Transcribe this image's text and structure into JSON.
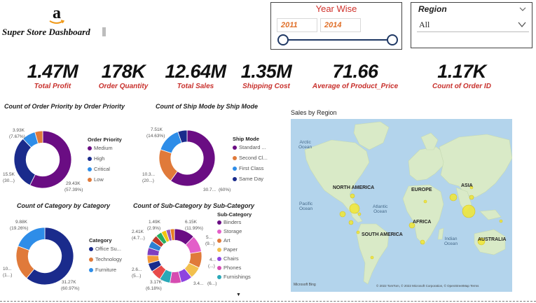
{
  "header": {
    "logo_text": "a",
    "title": "Super Store Dashboard"
  },
  "slicer_year": {
    "title": "Year Wise",
    "start": "2011",
    "end": "2014"
  },
  "slicer_region": {
    "title": "Region",
    "selected": "All"
  },
  "kpis": [
    {
      "value": "1.47M",
      "label": "Total Profit"
    },
    {
      "value": "178K",
      "label": "Order Quantity"
    },
    {
      "value": "12.64M",
      "label": "Total Sales"
    },
    {
      "value": "1.35M",
      "label": "Shipping Cost"
    },
    {
      "value": "71.66",
      "label": "Average of Product_Price"
    },
    {
      "value": "1.17K",
      "label": "Count of  Order ID"
    }
  ],
  "colors": {
    "accent_red": "#c8302c",
    "slider_blue": "#1f3864",
    "map_water": "#b3d4ec",
    "map_land": "#d9eac7"
  },
  "chart_data": [
    {
      "type": "pie",
      "title": "Count of Order Priority by Order Priority",
      "legend_title": "Order Priority",
      "categories": [
        "Medium",
        "High",
        "Critical",
        "Low"
      ],
      "values": [
        57.39,
        30.5,
        7.67,
        4.44
      ],
      "colors": [
        "#6a0d83",
        "#1a2b8c",
        "#2e8de8",
        "#e07a3a"
      ],
      "labels": {
        "a": "3.93K",
        "b": "(7.67%)",
        "c": "15.5K",
        "d": "(30...)",
        "e": "29.43K",
        "f": "(57.39%)"
      }
    },
    {
      "type": "pie",
      "title": "Count of Ship Mode by Ship Mode",
      "legend_title": "Ship Mode",
      "categories": [
        "Standard ...",
        "Second Cl...",
        "First Class",
        "Same Day"
      ],
      "values": [
        60,
        20,
        14.63,
        5.37
      ],
      "colors": [
        "#6a0d83",
        "#e07a3a",
        "#2e8de8",
        "#1a2b8c"
      ],
      "labels": {
        "a": "7.51K",
        "b": "(14.63%)",
        "c": "10.3...",
        "d": "(20...)",
        "e": "30.7...",
        "f": "(60%)"
      }
    },
    {
      "type": "pie",
      "title": "Count of Category by Category",
      "legend_title": "Category",
      "categories": [
        "Office Su...",
        "Technology",
        "Furniture"
      ],
      "values": [
        60.97,
        19.77,
        19.26
      ],
      "colors": [
        "#1a2b8c",
        "#e07a3a",
        "#2e8de8"
      ],
      "labels": {
        "a": "9.88K",
        "b": "(19.26%)",
        "c": "10...",
        "d": "(1...)",
        "e": "31.27K",
        "f": "(60.97%)"
      }
    },
    {
      "type": "pie",
      "title": "Count of Sub-Category by Sub-Category",
      "legend_title": "Sub-Category",
      "categories": [
        "Binders",
        "Storage",
        "Art",
        "Paper",
        "Chairs",
        "Phones",
        "Furnishings"
      ],
      "values": [
        11.99,
        9.7,
        9.4,
        6.9,
        6.6,
        6.5,
        6.2,
        6.18,
        5.0,
        4.7,
        4.5,
        4.2,
        3.8,
        3.5,
        2.9,
        2.5,
        2.4
      ],
      "colors": [
        "#6a0d83",
        "#e35fc9",
        "#e07a3a",
        "#f2c04e",
        "#8e44e0",
        "#d64cb1",
        "#2aa8b8",
        "#e84b4b",
        "#1a2b8c",
        "#f29a3a",
        "#7f3fbf",
        "#2b7fd4",
        "#c0392b",
        "#27ae60",
        "#f1c40f",
        "#9b59b6",
        "#e67e22"
      ],
      "labels": {
        "a": "1.49K",
        "b": "(2.9%)",
        "c": "2.41K",
        "d": "(4.7...)",
        "e": "6.15K",
        "f": "(11.99%)",
        "g": "5...",
        "h": "(9...)",
        "i": "4...",
        "j": "(...)",
        "k": "2.6...",
        "l": "(5...)",
        "m": "3.17K",
        "n": "(6.18%)",
        "o": "3.4...",
        "p": "(6...)"
      }
    }
  ],
  "map": {
    "title": "Sales by Region",
    "regions": [
      "NORTH AMERICA",
      "EUROPE",
      "ASIA",
      "AFRICA",
      "SOUTH AMERICA",
      "AUSTRALIA"
    ],
    "oceans": [
      "Arctic",
      "Ocean",
      "Pacific",
      "Ocean",
      "Atlantic",
      "Ocean",
      "Indian",
      "Ocean"
    ],
    "attribution": "Microsoft Bing",
    "copyright": "© 2022 TomTom, © 2022 Microsoft Corporation, © OpenStreetMap  Terms"
  }
}
